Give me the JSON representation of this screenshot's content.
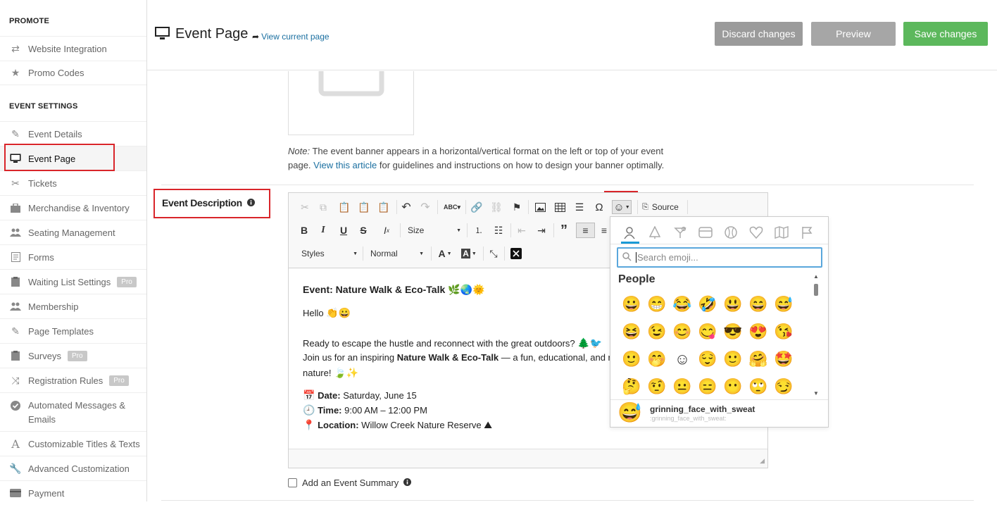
{
  "sidebar": {
    "promote_title": "PROMOTE",
    "event_settings_title": "EVENT SETTINGS",
    "promote_items": [
      {
        "label": "Website Integration",
        "icon": "arrows-swap-icon"
      },
      {
        "label": "Promo Codes",
        "icon": "star-icon"
      }
    ],
    "items": [
      {
        "label": "Event Details",
        "icon": "edit-icon"
      },
      {
        "label": "Event Page",
        "icon": "monitor-icon"
      },
      {
        "label": "Tickets",
        "icon": "ticket-icon"
      },
      {
        "label": "Merchandise & Inventory",
        "icon": "briefcase-icon"
      },
      {
        "label": "Seating Management",
        "icon": "users-icon"
      },
      {
        "label": "Forms",
        "icon": "form-icon"
      },
      {
        "label": "Waiting List Settings",
        "icon": "clipboard-icon",
        "badge": "Pro"
      },
      {
        "label": "Membership",
        "icon": "users-icon"
      },
      {
        "label": "Page Templates",
        "icon": "edit-icon"
      },
      {
        "label": "Surveys",
        "icon": "clipboard-icon",
        "badge": "Pro"
      },
      {
        "label": "Registration Rules",
        "icon": "shuffle-icon",
        "badge": "Pro"
      },
      {
        "label": "Automated Messages & Emails",
        "icon": "check-circle-icon"
      },
      {
        "label": "Customizable Titles & Texts",
        "icon": "letter-a-icon"
      },
      {
        "label": "Advanced Customization",
        "icon": "wrench-icon"
      },
      {
        "label": "Payment",
        "icon": "card-icon"
      }
    ]
  },
  "header": {
    "title": "Event Page",
    "view_link": "View current page",
    "discard": "Discard changes",
    "preview": "Preview",
    "save": "Save changes",
    "colors": {
      "discard": "#9b9b9b",
      "preview": "#a6a6a6",
      "save": "#5cb85c"
    }
  },
  "banner_note": {
    "note_label": "Note:",
    "text1": " The event banner appears in a horizontal/vertical format on the left or top of your event",
    "text2_pre": "page. ",
    "link": "View this article",
    "text2_post": " for guidelines and instructions on how to design your banner optimally."
  },
  "description": {
    "label": "Event Description",
    "toolbar": {
      "source": "Source",
      "size": "Size",
      "styles": "Styles",
      "format": "Normal"
    },
    "content": {
      "heading": "Event: Nature Walk & Eco-Talk",
      "heading_emoji": "🌿🌏🌞",
      "hello": "Hello",
      "hello_emoji": "👏😀",
      "line1": "Ready to escape the hustle and reconnect with the great outdoors?",
      "line1_emoji": "🌲🐦",
      "line2_pre": "Join us for an inspiring ",
      "line2_bold": "Nature Walk & Eco-Talk",
      "line2_post": " — a fun, educational, and r",
      "line3": "nature!",
      "line3_emoji": "🍃✨",
      "date_label": "Date:",
      "date_value": " Saturday, June 15",
      "time_label": "Time:",
      "time_value": " 9:00 AM – 12:00 PM",
      "loc_label": "Location:",
      "loc_value": " Willow Creek Nature Reserve",
      "date_emoji": "📅",
      "time_emoji": "🕘",
      "loc_emoji": "📍",
      "loc_end_emoji": "⛰"
    }
  },
  "emoji_panel": {
    "search_placeholder": "Search emoji...",
    "category": "People",
    "grid": [
      [
        "😀",
        "😁",
        "😂",
        "🤣",
        "😃",
        "😄",
        "😅"
      ],
      [
        "😆",
        "😉",
        "😊",
        "😋",
        "😎",
        "😍",
        "😘"
      ],
      [
        "🙂",
        "🤭",
        "☺",
        "😌",
        "🙂",
        "🤗",
        "🤩"
      ],
      [
        "🤔",
        "🤨",
        "😐",
        "😑",
        "😶",
        "🙄",
        "😏"
      ]
    ],
    "preview_emoji": "😅",
    "preview_name": "grinning_face_with_sweat",
    "preview_code": ":grinning_face_with_sweat:"
  },
  "summary_checkbox": "Add an Event Summary"
}
